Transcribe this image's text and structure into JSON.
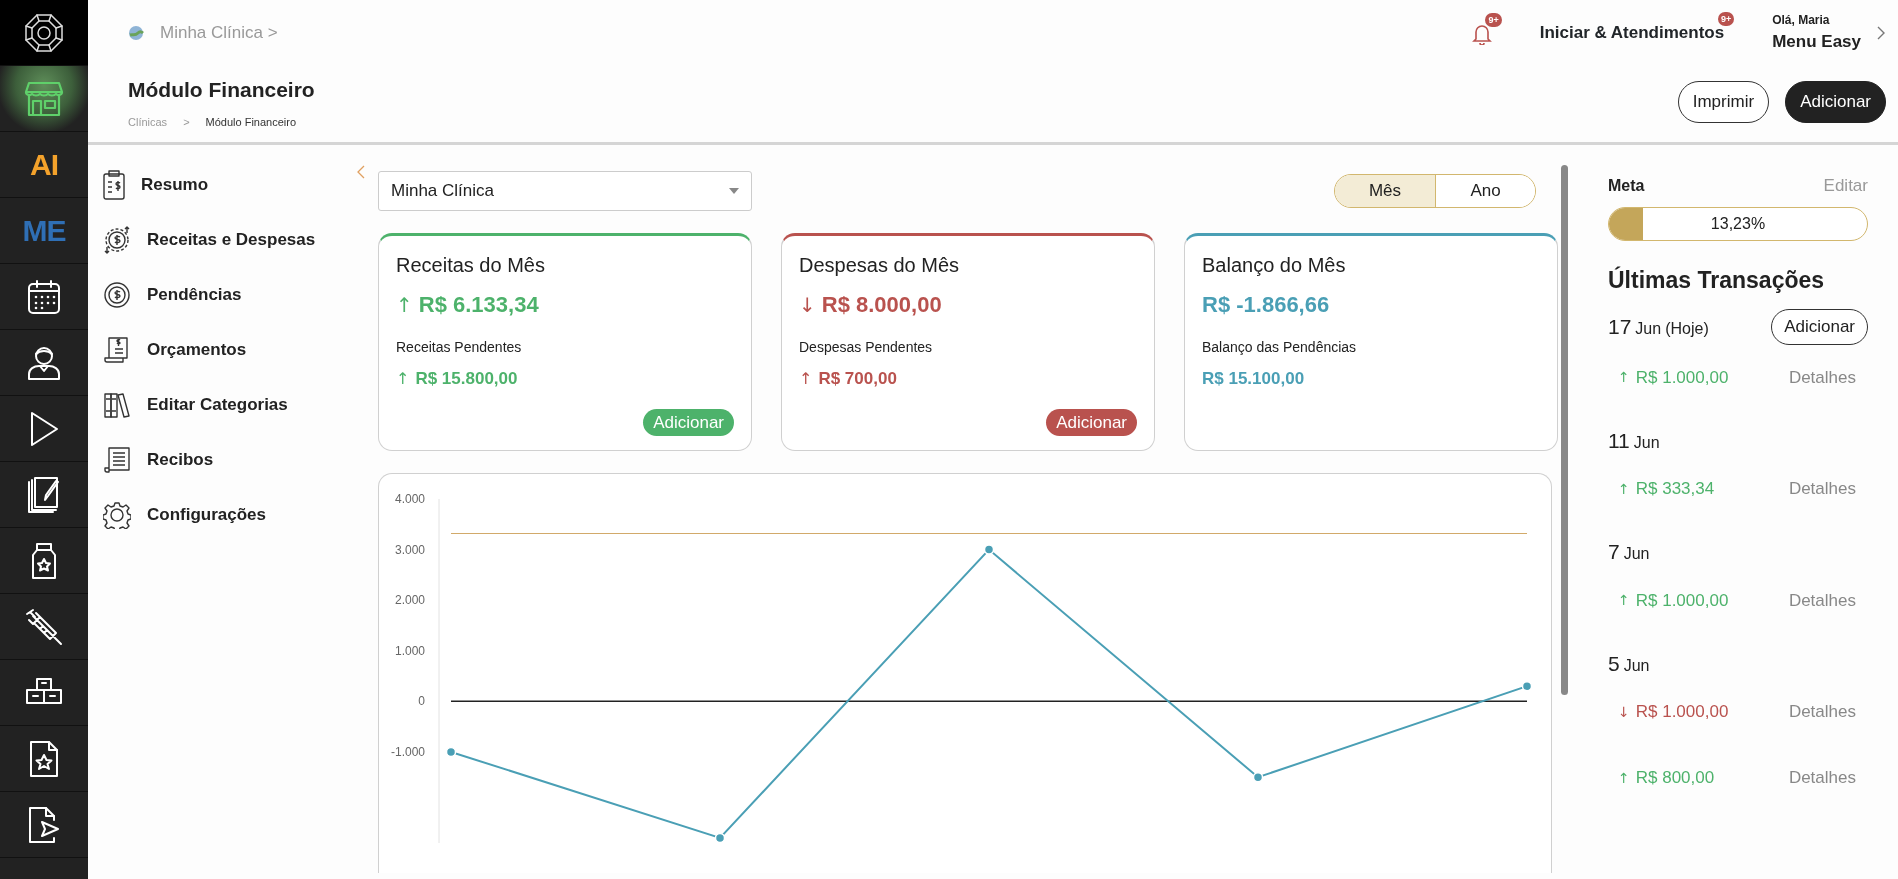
{
  "rail": [
    {
      "selected": true
    },
    {
      "label": "AI",
      "color": "#f4a22b",
      "selected": false
    },
    {
      "label": "ME",
      "color": "#2f6fb5",
      "selected": false
    },
    {
      "selected": false
    },
    {
      "selected": false
    },
    {
      "selected": false
    },
    {
      "selected": false
    },
    {
      "selected": false
    },
    {
      "selected": false
    },
    {
      "selected": false
    },
    {
      "selected": false
    },
    {
      "selected": false
    }
  ],
  "topbar": {
    "clinic": "Minha Clínica",
    "clinic_chevron": ">",
    "notifications_badge": "9+",
    "attendance": "Iniciar & Atendimentos",
    "attendance_badge": "9+",
    "greeting": "Olá, Maria",
    "user_menu": "Menu Easy"
  },
  "page": {
    "title": "Módulo Financeiro",
    "breadcrumb": [
      "Clínicas",
      "Módulo Financeiro"
    ],
    "breadcrumb_separator": ">",
    "buttons": [
      {
        "label": "Imprimir",
        "kind": "outline"
      },
      {
        "label": "Adicionar",
        "kind": "dark"
      }
    ]
  },
  "menu": [
    {
      "label": "Resumo"
    },
    {
      "label": "Receitas e Despesas"
    },
    {
      "label": "Pendências"
    },
    {
      "label": "Orçamentos"
    },
    {
      "label": "Editar Categorias"
    },
    {
      "label": "Recibos"
    },
    {
      "label": "Configurações"
    }
  ],
  "clinic_select": {
    "value": "Minha Clínica"
  },
  "period": [
    {
      "label": "Mês",
      "selected": true
    },
    {
      "label": "Ano",
      "selected": false
    }
  ],
  "cards": [
    {
      "title": "Receitas do Mês",
      "color": "#4db26b",
      "amount": "R$ 6.133,34",
      "arrow": "↑",
      "pending_label": "Receitas Pendentes",
      "pending_amount": "R$ 15.800,00",
      "pending_arrow": "↑",
      "button": "Adicionar"
    },
    {
      "title": "Despesas do Mês",
      "color": "#b9524e",
      "amount": "R$ 8.000,00",
      "arrow": "↓",
      "pending_label": "Despesas Pendentes",
      "pending_amount": "R$ 700,00",
      "pending_arrow": "↑",
      "button": "Adicionar"
    },
    {
      "title": "Balanço do Mês",
      "color": "#4a9fb5",
      "amount": "R$ -1.866,66",
      "pending_label": "Balanço das Pendências",
      "pending_amount": "R$ 15.100,00"
    }
  ],
  "chart_data": {
    "type": "line",
    "categories": [
      null,
      null,
      null,
      null,
      null
    ],
    "series": [
      {
        "color": "#4a9fb5",
        "marker": "circle",
        "values": [
          -1000,
          -2700,
          3000,
          -1500,
          300
        ]
      }
    ],
    "ylim": [
      -2800,
      4000
    ],
    "yticks": [
      {
        "value": -1000,
        "label": "-1.000"
      },
      {
        "value": 0,
        "label": "0"
      },
      {
        "value": 1000,
        "label": "1.000"
      },
      {
        "value": 2000,
        "label": "2.000"
      },
      {
        "value": 3000,
        "label": "3.000"
      },
      {
        "value": 4000,
        "label": "4.000"
      }
    ]
  },
  "goal": {
    "label": "Meta",
    "edit": "Editar",
    "level": 0.1323,
    "reading": "13,23%"
  },
  "transactions": {
    "title": "Últimas Transações",
    "groups": [
      {
        "day": "17",
        "month": "Jun",
        "note": "(Hoje)",
        "button": "Adicionar",
        "items": [
          {
            "arrow": "↑",
            "color": "#4db26b",
            "amount": "R$ 1.000,00",
            "link": "Detalhes"
          }
        ]
      },
      {
        "day": "11",
        "month": "Jun",
        "items": [
          {
            "arrow": "↑",
            "color": "#4db26b",
            "amount": "R$ 333,34",
            "link": "Detalhes"
          }
        ]
      },
      {
        "day": "7",
        "month": "Jun",
        "items": [
          {
            "arrow": "↑",
            "color": "#4db26b",
            "amount": "R$ 1.000,00",
            "link": "Detalhes"
          }
        ]
      },
      {
        "day": "5",
        "month": "Jun",
        "items": [
          {
            "arrow": "↓",
            "color": "#b9524e",
            "amount": "R$ 1.000,00",
            "link": "Detalhes"
          },
          {
            "arrow": "↑",
            "color": "#4db26b",
            "amount": "R$ 800,00",
            "link": "Detalhes"
          }
        ]
      }
    ]
  }
}
